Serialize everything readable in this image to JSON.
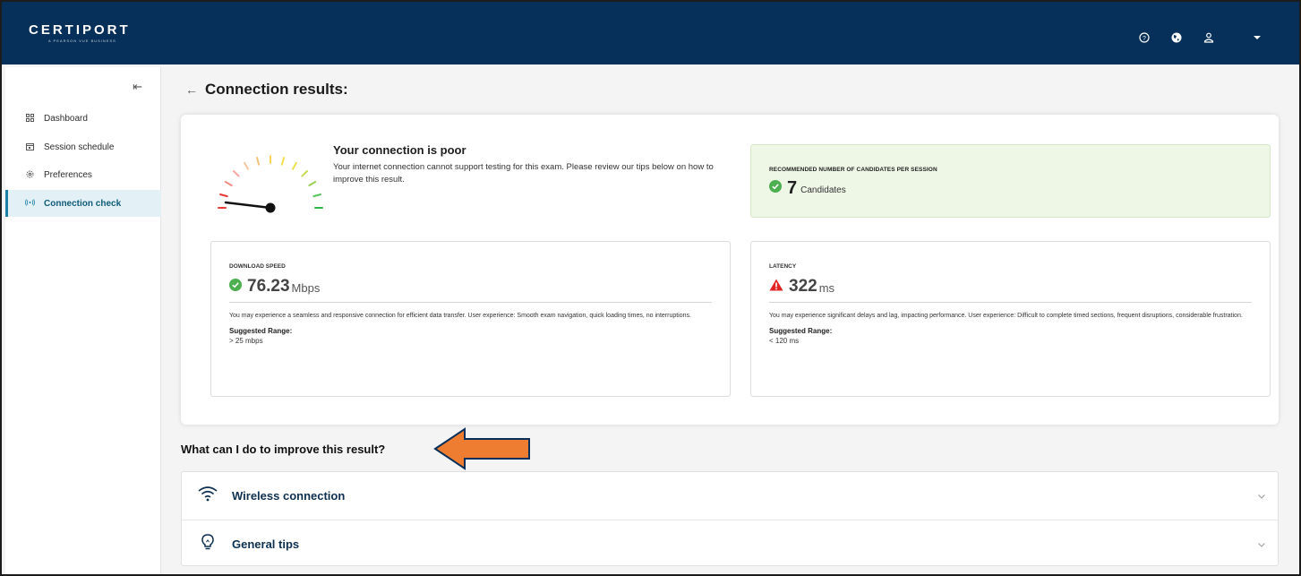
{
  "header": {
    "brand": "CERTIPORT",
    "tagline": "A PEARSON VUE BUSINESS",
    "icons": [
      "help-icon",
      "globe-icon",
      "user-icon",
      "caret-down-icon"
    ],
    "color": "#06305a"
  },
  "sidebar": {
    "collapse_glyph": "⇤",
    "items": [
      {
        "label": "Dashboard",
        "icon": "grid-icon"
      },
      {
        "label": "Session schedule",
        "icon": "calendar-icon"
      },
      {
        "label": "Preferences",
        "icon": "gear-icon"
      },
      {
        "label": "Connection check",
        "icon": "signal-icon",
        "active": true
      }
    ]
  },
  "page": {
    "back": "←",
    "title": "Connection results:"
  },
  "result": {
    "heading": "Your connection is poor",
    "description": "Your internet connection cannot support testing for this exam. Please review our tips below on how to improve this result."
  },
  "recommendation": {
    "label": "RECOMMENDED NUMBER OF CANDIDATES PER SESSION",
    "value": "7",
    "unit": "Candidates",
    "color": "#eef6e6"
  },
  "download": {
    "label": "DOWNLOAD SPEED",
    "value": "76.23",
    "unit": "Mbps",
    "status": "good",
    "description": "You may experience a seamless and responsive connection for efficient data transfer. User experience: Smooth exam navigation, quick loading times, no interruptions.",
    "range_label": "Suggested Range:",
    "range_value": "> 25 mbps"
  },
  "latency": {
    "label": "LATENCY",
    "value": "322",
    "unit": "ms",
    "status": "warning",
    "description": "You may experience significant delays and lag, impacting performance. User experience: Difficult to complete timed sections, frequent disruptions, considerable frustration.",
    "range_label": "Suggested Range:",
    "range_value": "< 120 ms"
  },
  "tips": {
    "heading": "What can I do to improve this result?",
    "items": [
      {
        "label": "Wireless connection",
        "icon": "wifi-icon"
      },
      {
        "label": "General tips",
        "icon": "lightbulb-icon"
      }
    ]
  },
  "colors": {
    "good": "#4caf50",
    "warning": "#e02424",
    "accent": "#1b7fa6",
    "annotation_arrow": "#ee7d31"
  }
}
